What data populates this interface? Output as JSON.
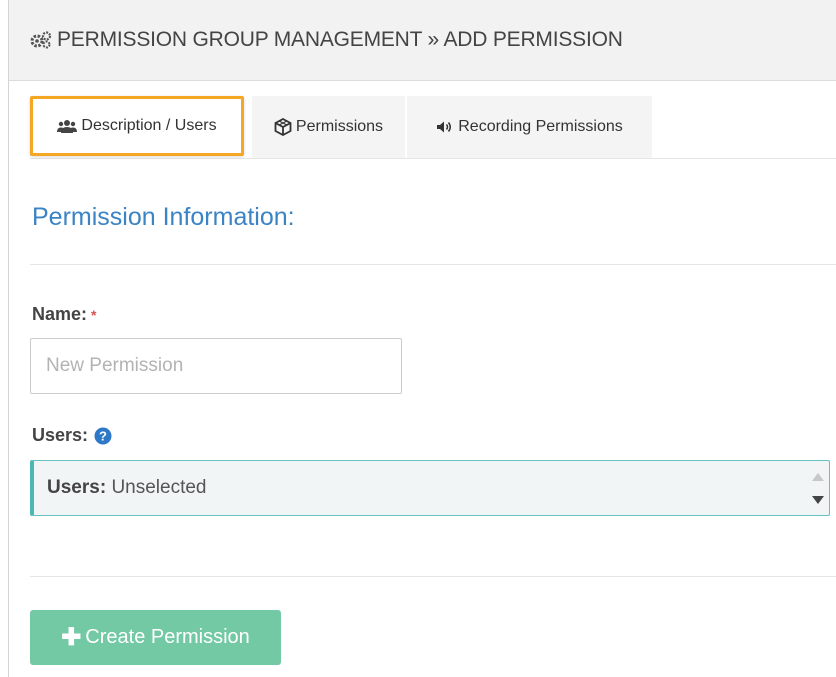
{
  "header": {
    "icon": "gears-icon",
    "title": "PERMISSION GROUP MANAGEMENT » ADD PERMISSION"
  },
  "tabs": [
    {
      "label": "Description / Users",
      "icon": "users-icon",
      "active": true
    },
    {
      "label": "Permissions",
      "icon": "cube-icon",
      "active": false
    },
    {
      "label": "Recording Permissions",
      "icon": "speaker-icon",
      "active": false
    }
  ],
  "form": {
    "section_title": "Permission Information:",
    "name_label": "Name:",
    "required_mark": "*",
    "name_placeholder": "New Permission",
    "name_value": "",
    "users_label": "Users:",
    "users_select_label": "Users:",
    "users_select_value": "Unselected",
    "submit_label": "Create Permission"
  },
  "colors": {
    "accent_blue": "#3a83c4",
    "tab_highlight": "#f5a623",
    "select_border": "#4bb7b7",
    "button_bg": "#72c9a3",
    "required": "#d9534f"
  }
}
